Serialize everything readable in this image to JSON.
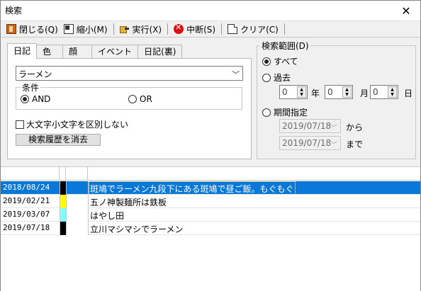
{
  "window": {
    "title": "検索",
    "close_glyph": "✕"
  },
  "toolbar": {
    "close_label": "閉じる(Q)",
    "shrink_label": "縮小(M)",
    "run_label": "実行(X)",
    "stop_label": "中断(S)",
    "clear_label": "クリア(C)"
  },
  "tabs": [
    "日記",
    "色",
    "顔",
    "イベント",
    "日記(裏)"
  ],
  "search": {
    "query": "ラーメン",
    "condition_legend": "条件",
    "and_label": "AND",
    "or_label": "OR",
    "selected_condition": "AND",
    "case_label": "大文字小文字を区別しない",
    "case_checked": false,
    "clear_history_label": "検索履歴を消去"
  },
  "range": {
    "legend": "検索範囲(D)",
    "all_label": "すべて",
    "past_label": "過去",
    "period_label": "期間指定",
    "selected": "すべて",
    "year_value": "0",
    "year_unit": "年",
    "month_value": "0",
    "month_unit": "月",
    "day_value": "0",
    "day_unit": "日",
    "from_date": "2019/07/18",
    "from_label": "から",
    "to_date": "2019/07/18",
    "to_label": "まで"
  },
  "results": [
    {
      "date": "2018/08/24",
      "color": "#000000",
      "text": "斑鳩でラーメン九段下にある斑鳩で昼ご飯。もぐもぐ",
      "selected": true
    },
    {
      "date": "2019/02/21",
      "color": "#ffff00",
      "text": "五ノ神製麺所は鉄板",
      "selected": false
    },
    {
      "date": "2019/03/07",
      "color": "#80ffff",
      "text": "はやし田",
      "selected": false
    },
    {
      "date": "2019/07/18",
      "color": "#000000",
      "text": "立川マシマシでラーメン",
      "selected": false
    }
  ],
  "colors": {
    "selection": "#0a78d7"
  }
}
